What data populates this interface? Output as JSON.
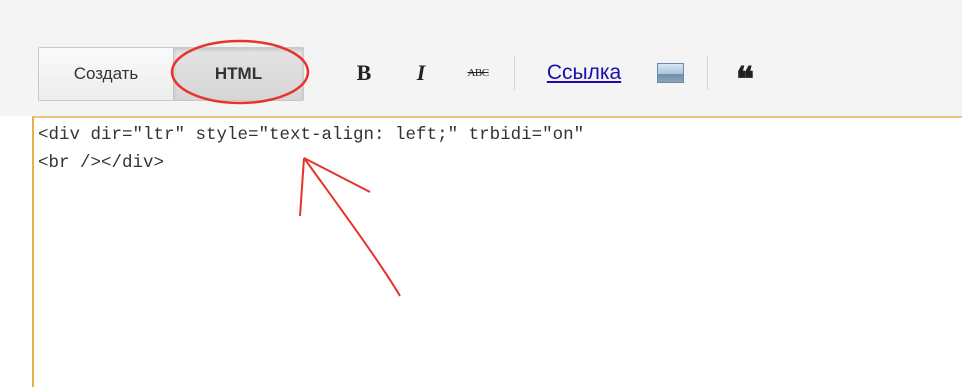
{
  "toolbar": {
    "compose_label": "Создать",
    "html_label": "HTML",
    "bold_label": "B",
    "italic_label": "I",
    "strike_label": "ABC",
    "link_label": "Ссылка",
    "image_icon": "image-icon",
    "quote_icon": "quote-icon",
    "quote_glyph": "❝"
  },
  "editor": {
    "line1": "<div dir=\"ltr\" style=\"text-align: left;\" trbidi=\"on\"",
    "line2": "<br /></div>"
  },
  "annotation": {
    "color": "#e8322a",
    "shapes": [
      "ellipse-around-html-button",
      "arrow-pointing-to-ltr"
    ]
  },
  "colors": {
    "toolbar_bg": "#f4f4f4",
    "editor_border": "#e2b14e",
    "link": "#1a0dab"
  }
}
